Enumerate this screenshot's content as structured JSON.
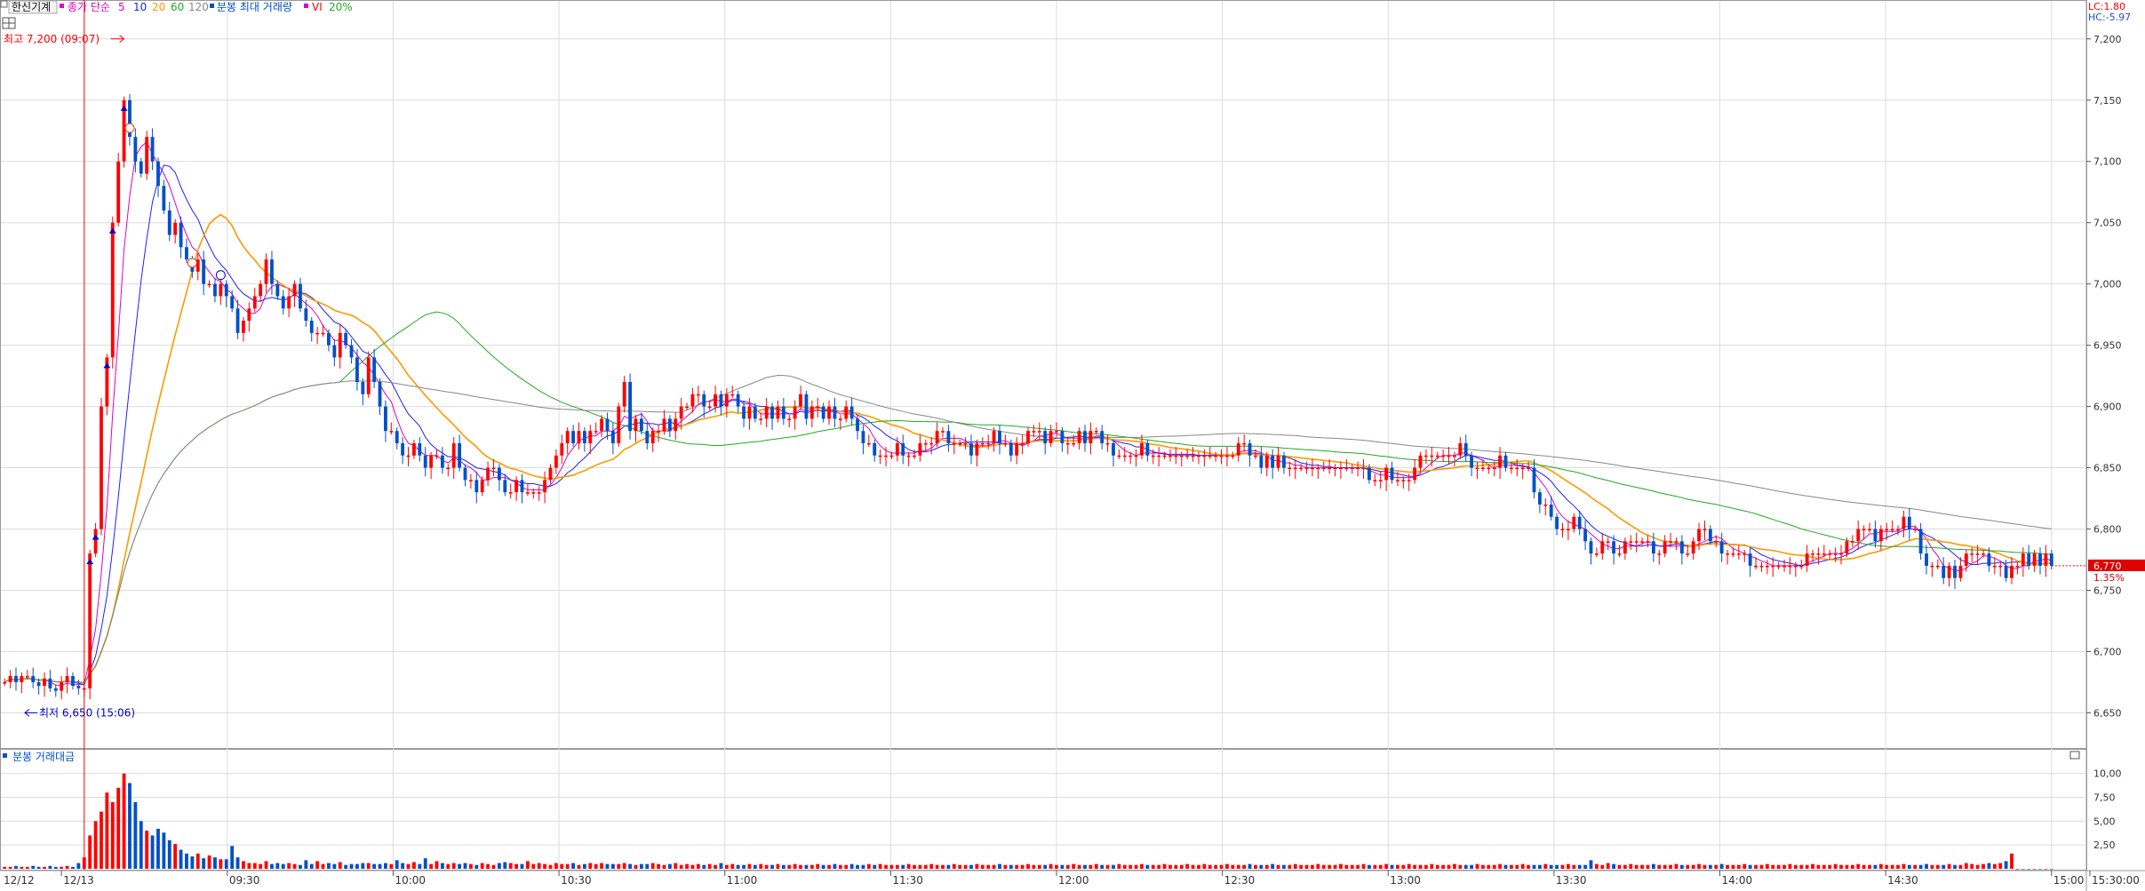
{
  "toolbar": {
    "title": "한신기계",
    "price_label": "종가 단순",
    "ma_labels": [
      "5",
      "10",
      "20",
      "60",
      "120"
    ],
    "ma_colors": [
      "#e000c8",
      "#2020ff",
      "#ff9900",
      "#22aa22",
      "#888888"
    ],
    "volume_label": "분봉 최대 거래량",
    "vi_label": "VI",
    "vi_pct": "20%"
  },
  "limits": {
    "lc": "LC:1.80",
    "hc": "HC:-5.97"
  },
  "annotations": {
    "high": "최고 7,200 (09:07)",
    "low": "최저 6,650 (15:06)",
    "current_price": "6,770",
    "current_pct": "1.35%"
  },
  "sub_panel": {
    "title": "분봉 거래대금"
  },
  "colors": {
    "up": "#ff0000",
    "down": "#0050c8",
    "grid": "#dcdcdc",
    "axis": "#333333",
    "vi_line": "#ff0000"
  },
  "chart_data": {
    "type": "candlestick",
    "price_ylim": [
      6630,
      7210
    ],
    "price_yticks": [
      6650,
      6700,
      6750,
      6800,
      6850,
      6900,
      6950,
      7000,
      7050,
      7100,
      7150,
      7200
    ],
    "price_ytick_labels": [
      "6,650",
      "6,700",
      "6,750",
      "6,800",
      "6,850",
      "6,900",
      "6,950",
      "7,000",
      "7,050",
      "7,100",
      "7,150",
      "7,200"
    ],
    "volume_ylim": [
      0,
      11
    ],
    "volume_yticks": [
      2.5,
      5.0,
      7.5,
      10.0
    ],
    "volume_ytick_labels": [
      "2,50",
      "5,00",
      "7,50",
      "10,00"
    ],
    "x_time_labels": [
      "12/12",
      "12/13",
      "09:30",
      "10:00",
      "10:30",
      "11:00",
      "11:30",
      "12:00",
      "12:30",
      "13:00",
      "13:30",
      "14:00",
      "14:30",
      "15:00",
      "15:30:00"
    ],
    "bars_per_day_prev": 10,
    "vi_bar_index": 14,
    "high_point": {
      "time": "09:07",
      "value": 7200
    },
    "low_point": {
      "time": "15:06",
      "value": 6650
    },
    "current_value": 6770,
    "close": [
      6675,
      6680,
      6675,
      6680,
      6680,
      6675,
      6672,
      6678,
      6670,
      6668,
      6675,
      6680,
      6672,
      6670,
      6670,
      6780,
      6800,
      6900,
      6940,
      7050,
      7100,
      7150,
      7120,
      7100,
      7090,
      7120,
      7100,
      7080,
      7060,
      7040,
      7050,
      7030,
      7020,
      7010,
      7020,
      7000,
      7000,
      6990,
      7000,
      6990,
      6980,
      6960,
      6970,
      6980,
      6990,
      7000,
      7020,
      7000,
      6990,
      6980,
      6990,
      7000,
      6980,
      6970,
      6960,
      6960,
      6960,
      6950,
      6940,
      6960,
      6950,
      6940,
      6920,
      6910,
      6940,
      6920,
      6900,
      6880,
      6880,
      6870,
      6860,
      6860,
      6870,
      6860,
      6850,
      6860,
      6860,
      6850,
      6850,
      6870,
      6850,
      6840,
      6840,
      6830,
      6840,
      6850,
      6850,
      6840,
      6830,
      6830,
      6840,
      6830,
      6830,
      6830,
      6830,
      6840,
      6850,
      6860,
      6870,
      6880,
      6870,
      6880,
      6870,
      6880,
      6880,
      6890,
      6880,
      6870,
      6900,
      6920,
      6880,
      6890,
      6880,
      6870,
      6880,
      6880,
      6890,
      6880,
      6890,
      6900,
      6900,
      6910,
      6910,
      6900,
      6900,
      6910,
      6900,
      6910,
      6910,
      6900,
      6890,
      6900,
      6890,
      6890,
      6900,
      6890,
      6900,
      6890,
      6890,
      6900,
      6910,
      6890,
      6900,
      6900,
      6890,
      6900,
      6890,
      6890,
      6900,
      6890,
      6880,
      6870,
      6870,
      6860,
      6860,
      6860,
      6860,
      6870,
      6860,
      6860,
      6860,
      6870,
      6870,
      6870,
      6880,
      6880,
      6870,
      6870,
      6870,
      6870,
      6860,
      6870,
      6870,
      6870,
      6880,
      6870,
      6870,
      6860,
      6870,
      6870,
      6880,
      6880,
      6880,
      6870,
      6880,
      6880,
      6870,
      6870,
      6870,
      6880,
      6870,
      6880,
      6880,
      6870,
      6870,
      6860,
      6860,
      6860,
      6860,
      6860,
      6870,
      6860,
      6860,
      6860,
      6860,
      6860,
      6860,
      6860,
      6860,
      6860,
      6860,
      6860,
      6860,
      6860,
      6860,
      6860,
      6860,
      6870,
      6870,
      6860,
      6860,
      6850,
      6860,
      6850,
      6860,
      6850,
      6850,
      6850,
      6850,
      6850,
      6850,
      6850,
      6850,
      6850,
      6850,
      6850,
      6850,
      6850,
      6850,
      6850,
      6840,
      6840,
      6840,
      6850,
      6840,
      6840,
      6840,
      6840,
      6850,
      6860,
      6860,
      6860,
      6860,
      6860,
      6860,
      6860,
      6870,
      6860,
      6850,
      6850,
      6850,
      6850,
      6850,
      6860,
      6850,
      6850,
      6850,
      6850,
      6850,
      6830,
      6820,
      6820,
      6810,
      6800,
      6800,
      6800,
      6810,
      6800,
      6790,
      6780,
      6780,
      6790,
      6790,
      6780,
      6780,
      6790,
      6790,
      6790,
      6790,
      6790,
      6780,
      6780,
      6790,
      6790,
      6790,
      6780,
      6780,
      6790,
      6800,
      6800,
      6790,
      6790,
      6780,
      6780,
      6780,
      6780,
      6780,
      6770,
      6770,
      6770,
      6770,
      6770,
      6770,
      6770,
      6770,
      6770,
      6770,
      6780,
      6780,
      6780,
      6780,
      6780,
      6780,
      6780,
      6790,
      6790,
      6800,
      6800,
      6800,
      6790,
      6800,
      6800,
      6800,
      6800,
      6810,
      6800,
      6800,
      6780,
      6770,
      6770,
      6770,
      6760,
      6770,
      6760,
      6770,
      6780,
      6780,
      6780,
      6780,
      6770,
      6770,
      6770,
      6760,
      6770,
      6770,
      6780,
      6770,
      6780,
      6770,
      6780,
      6770
    ],
    "volume": [
      0.2,
      0.2,
      0.3,
      0.2,
      0.2,
      0.3,
      0.2,
      0.2,
      0.3,
      0.2,
      0.2,
      0.3,
      0.2,
      0.6,
      1.2,
      3.5,
      5.0,
      6.0,
      8.0,
      7.0,
      8.5,
      10.0,
      9.0,
      7.0,
      5.0,
      4.0,
      3.5,
      4.2,
      3.8,
      3.0,
      2.6,
      2.0,
      1.6,
      1.3,
      1.6,
      1.1,
      1.4,
      1.2,
      1.0,
      1.0,
      2.4,
      1.2,
      0.8,
      0.6,
      0.6,
      0.5,
      0.8,
      0.5,
      0.6,
      0.5,
      0.6,
      0.5,
      0.4,
      0.9,
      0.5,
      0.8,
      0.5,
      0.6,
      0.5,
      0.7,
      0.4,
      0.5,
      0.5,
      0.6,
      0.6,
      0.5,
      0.5,
      0.6,
      0.5,
      0.9,
      0.6,
      0.5,
      0.7,
      0.5,
      1.1,
      0.5,
      0.8,
      0.6,
      0.5,
      0.6,
      0.5,
      0.6,
      0.5,
      0.4,
      0.6,
      0.5,
      0.4,
      0.6,
      0.7,
      0.6,
      0.5,
      0.5,
      0.8,
      0.5,
      0.6,
      0.5,
      0.4,
      0.6,
      0.5,
      0.5,
      0.6,
      0.4,
      0.5,
      0.6,
      0.5,
      0.6,
      0.5,
      0.5,
      0.5,
      0.6,
      0.5,
      0.4,
      0.5,
      0.5,
      0.6,
      0.5,
      0.4,
      0.5,
      0.6,
      0.4,
      0.5,
      0.4,
      0.5,
      0.4,
      0.5,
      0.4,
      0.6,
      0.4,
      0.5,
      0.4,
      0.4,
      0.5,
      0.4,
      0.5,
      0.4,
      0.4,
      0.5,
      0.4,
      0.4,
      0.5,
      0.4,
      0.4,
      0.4,
      0.5,
      0.4,
      0.4,
      0.5,
      0.4,
      0.4,
      0.5,
      0.4,
      0.4,
      0.5,
      0.4,
      0.5,
      0.4,
      0.4,
      0.4,
      0.4,
      0.5,
      0.4,
      0.4,
      0.4,
      0.5,
      0.4,
      0.4,
      0.4,
      0.5,
      0.4,
      0.4,
      0.4,
      0.5,
      0.4,
      0.4,
      0.4,
      0.5,
      0.4,
      0.4,
      0.4,
      0.4,
      0.5,
      0.4,
      0.4,
      0.4,
      0.5,
      0.4,
      0.4,
      0.4,
      0.5,
      0.4,
      0.4,
      0.4,
      0.5,
      0.4,
      0.4,
      0.4,
      0.5,
      0.4,
      0.4,
      0.4,
      0.5,
      0.4,
      0.4,
      0.4,
      0.5,
      0.4,
      0.4,
      0.4,
      0.5,
      0.4,
      0.4,
      0.5,
      0.4,
      0.4,
      0.4,
      0.5,
      0.4,
      0.4,
      0.4,
      0.5,
      0.4,
      0.4,
      0.4,
      0.5,
      0.4,
      0.4,
      0.4,
      0.5,
      0.4,
      0.4,
      0.4,
      0.5,
      0.4,
      0.4,
      0.4,
      0.5,
      0.4,
      0.4,
      0.4,
      0.5,
      0.4,
      0.4,
      0.4,
      0.5,
      0.4,
      0.4,
      0.4,
      0.5,
      0.4,
      0.4,
      0.4,
      0.5,
      0.4,
      0.4,
      0.4,
      0.5,
      0.4,
      0.4,
      0.4,
      0.5,
      0.4,
      0.4,
      0.4,
      0.5,
      0.4,
      0.4,
      0.4,
      0.5,
      0.4,
      0.4,
      0.4,
      0.5,
      0.4,
      0.4,
      0.4,
      0.5,
      0.4,
      0.4,
      0.4,
      0.9,
      0.5,
      0.4,
      0.6,
      0.5,
      0.4,
      0.4,
      0.5,
      0.4,
      0.4,
      0.4,
      0.5,
      0.4,
      0.4,
      0.4,
      0.5,
      0.4,
      0.4,
      0.4,
      0.5,
      0.4,
      0.4,
      0.4,
      0.5,
      0.4,
      0.4,
      0.4,
      0.5,
      0.4,
      0.4,
      0.4,
      0.5,
      0.4,
      0.4,
      0.4,
      0.5,
      0.4,
      0.4,
      0.4,
      0.5,
      0.4,
      0.4,
      0.4,
      0.5,
      0.4,
      0.4,
      0.4,
      0.5,
      0.4,
      0.4,
      0.4,
      0.5,
      0.4,
      0.4,
      0.4,
      0.5,
      0.4,
      0.4,
      0.4,
      0.5,
      0.4,
      0.4,
      0.4,
      0.5,
      0.4,
      0.4,
      0.6,
      0.5,
      0.4,
      0.5,
      0.6,
      0.5,
      0.6,
      0.8,
      1.6
    ]
  }
}
